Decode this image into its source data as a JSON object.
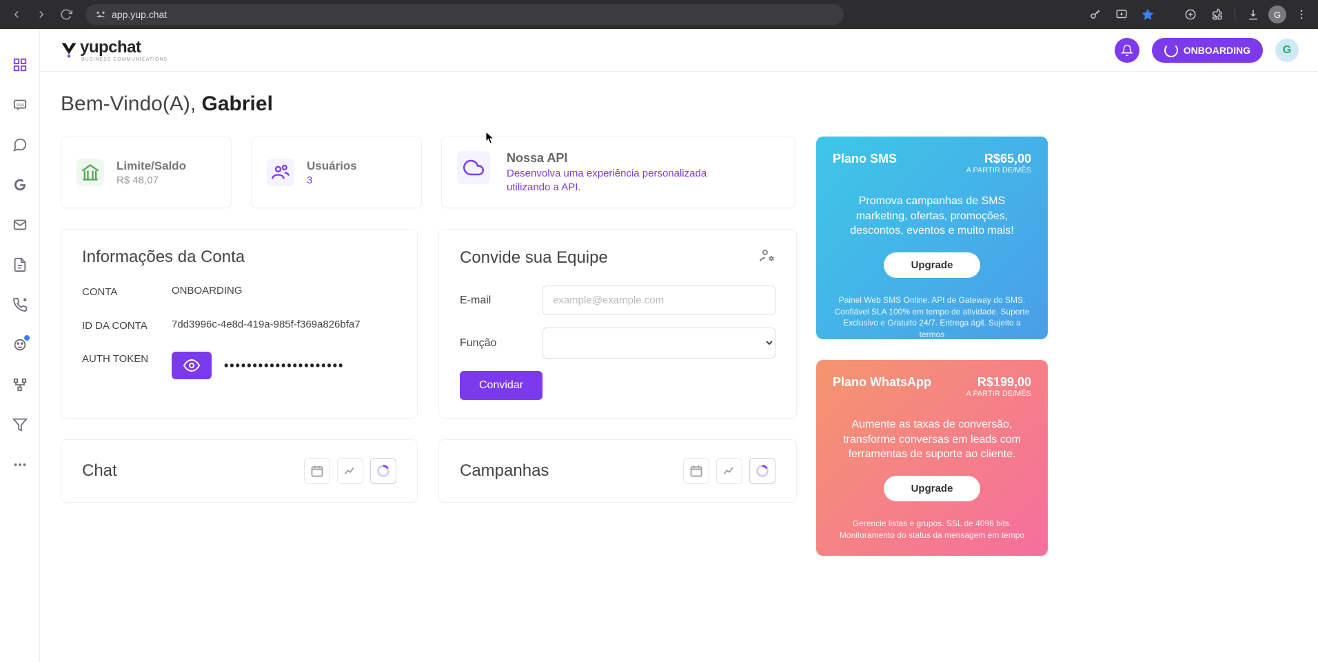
{
  "browser": {
    "url": "app.yup.chat",
    "avatar_letter": "G"
  },
  "header": {
    "brand": "yupchat",
    "brand_sub": "BUSINESS COMMUNICATIONS",
    "onboarding_label": "ONBOARDING",
    "user_initial": "G"
  },
  "welcome": {
    "greeting": "Bem-Vindo(A), ",
    "name": "Gabriel"
  },
  "stats": {
    "balance_label": "Limite/Saldo",
    "balance_value": "R$ 48,07",
    "users_label": "Usuários",
    "users_value": "3",
    "api_title": "Nossa API",
    "api_desc": "Desenvolva uma experiência personalizada utilizando a API."
  },
  "account_info": {
    "title": "Informações da Conta",
    "rows": {
      "conta_label": "CONTA",
      "conta_value": "ONBOARDING",
      "id_label": "ID DA CONTA",
      "id_value": "7dd3996c-4e8d-419a-985f-f369a826bfa7",
      "token_label": "AUTH TOKEN",
      "token_masked": "•••••••••••••••••••••"
    }
  },
  "invite": {
    "title": "Convide sua Equipe",
    "email_label": "E-mail",
    "email_placeholder": "example@example.com",
    "role_label": "Função",
    "button": "Convidar"
  },
  "promo_sms": {
    "title": "Plano SMS",
    "price": "R$65,00",
    "price_sub": "A PARTIR DE/MÊS",
    "body": "Promova campanhas de SMS marketing, ofertas, promoções, descontos, eventos e muito mais!",
    "button": "Upgrade",
    "footer": "Painel Web SMS Online. API de Gateway do SMS. Confiável SLA 100% em tempo de atividade. Suporte Exclusivo e Gratuito 24/7. Entrega ágil. Sujeito a termos"
  },
  "promo_wa": {
    "title": "Plano WhatsApp",
    "price": "R$199,00",
    "price_sub": "A PARTIR DE/MÊS",
    "body": "Aumente as taxas de conversão, transforme conversas em leads com ferramentas de suporte ao cliente.",
    "button": "Upgrade",
    "footer": "Gerencie listas e grupos. SSL de 4096 bits. Monitoramento do status da mensagem em tempo"
  },
  "charts": {
    "chat_title": "Chat",
    "campaigns_title": "Campanhas"
  }
}
